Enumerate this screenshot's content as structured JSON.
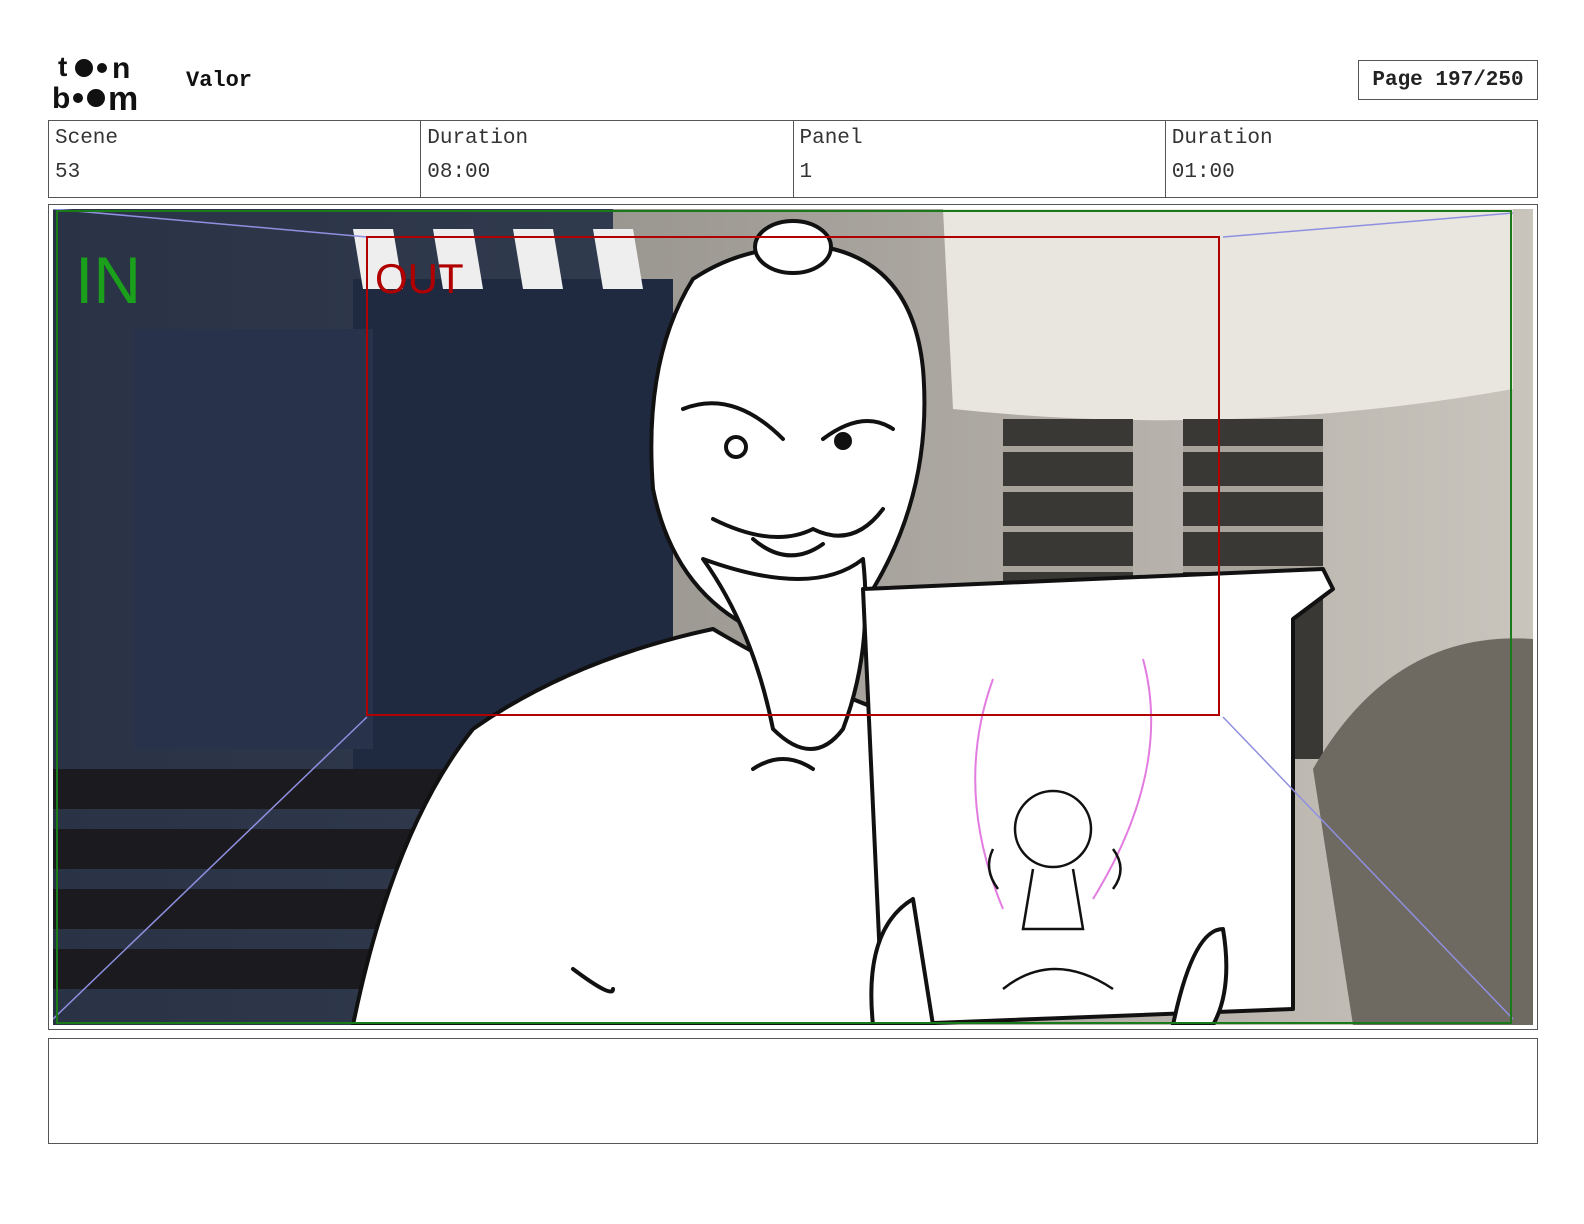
{
  "header": {
    "logo_text": "toon boom",
    "project_title": "Valor",
    "page_indicator": "Page 197/250"
  },
  "info": {
    "scene_label": "Scene",
    "scene_value": "53",
    "scene_duration_label": "Duration",
    "scene_duration_value": "08:00",
    "panel_label": "Panel",
    "panel_value": "1",
    "panel_duration_label": "Duration",
    "panel_duration_value": "01:00"
  },
  "panel": {
    "in_label": "IN",
    "out_label": "OUT",
    "in_color": "#1aa01a",
    "out_color": "#b00000"
  },
  "notes": {
    "text": ""
  }
}
